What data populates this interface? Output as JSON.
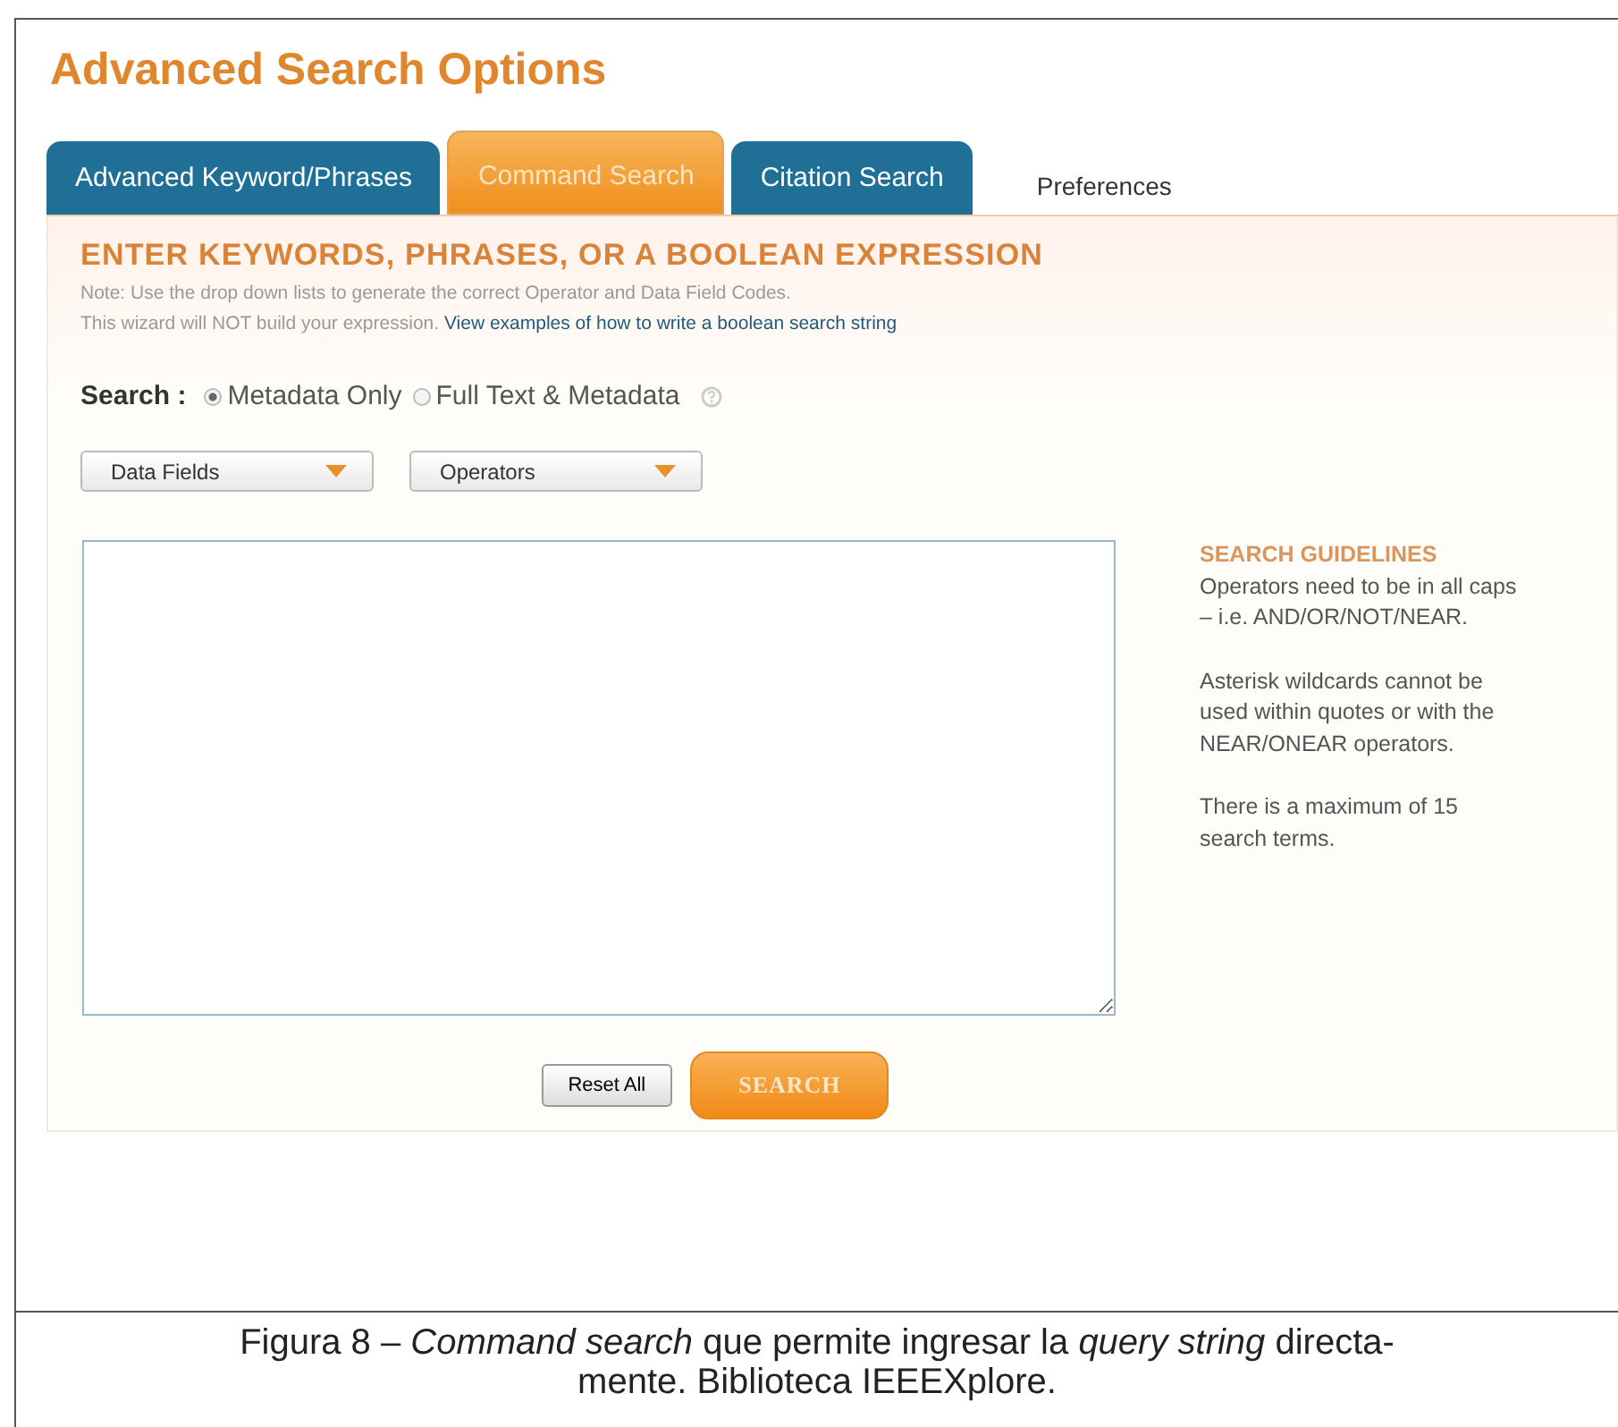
{
  "title": "Advanced Search Options",
  "tabs": [
    {
      "label": "Advanced Keyword/Phrases",
      "selected": false,
      "kind": "tab"
    },
    {
      "label": "Command Search",
      "selected": true,
      "kind": "tab"
    },
    {
      "label": "Citation Search",
      "selected": false,
      "kind": "tab"
    },
    {
      "label": "Preferences",
      "selected": false,
      "kind": "link"
    }
  ],
  "heading": "ENTER KEYWORDS, PHRASES, OR A BOOLEAN EXPRESSION",
  "note_lines": [
    "Note: Use the drop down lists to generate the correct Operator and Data Field Codes."
  ],
  "wizard_note": "This wizard will NOT build your expression.",
  "wizard_link": "View examples of how to write a boolean search string",
  "search_label": "Search :",
  "search_options": [
    {
      "label": "Metadata Only",
      "selected": true
    },
    {
      "label": "Full Text & Metadata",
      "selected": false
    }
  ],
  "dropdowns": [
    "Data Fields",
    "Operators"
  ],
  "guidelines": {
    "title": "SEARCH GUIDELINES",
    "paragraphs": [
      "Operators need to be in all caps – i.e. AND/OR/NOT/NEAR.",
      "Asterisk wildcards cannot be used within quotes or with the NEAR/ONEAR operators.",
      "There is a maximum of 15 search terms."
    ]
  },
  "buttons": {
    "reset": "Reset All",
    "search": "SEARCH"
  },
  "caption_lines": [
    "Figura 8 – *Command search* que permite ingresar la *query string* directa-",
    "mente. Biblioteca IEEEXplore."
  ]
}
